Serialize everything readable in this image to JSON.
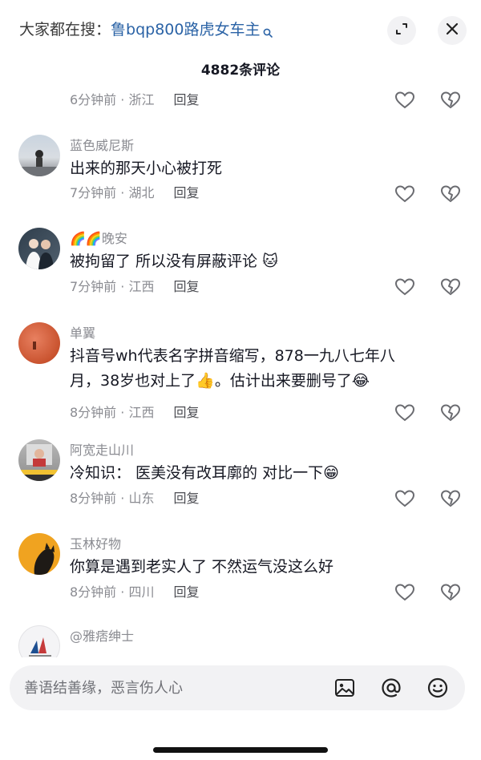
{
  "header": {
    "search_prefix": "大家都在搜：",
    "search_keyword": "鲁bqp800路虎女车主",
    "comment_count": "4882条评论"
  },
  "comments": [
    {
      "username": "",
      "text": "",
      "time": "6分钟前",
      "location": "浙江",
      "reply": "回复"
    },
    {
      "username": "蓝色威尼斯",
      "text": "出来的那天小心被打死",
      "time": "7分钟前",
      "location": "湖北",
      "reply": "回复"
    },
    {
      "username": "🌈🌈晚安",
      "text": "被拘留了 所以没有屏蔽评论",
      "emoji": "🐱",
      "time": "7分钟前",
      "location": "江西",
      "reply": "回复"
    },
    {
      "username": "单翼",
      "text_line1": "抖音号wh代表名字拼音缩写，878一九八七年八",
      "text_line2": "月，38岁也对上了",
      "emoji1": "👍",
      "text_line2b": "。估计出来要删号了",
      "emoji2": "😂",
      "time": "8分钟前",
      "location": "江西",
      "reply": "回复"
    },
    {
      "username": "阿宽走山川",
      "text": "冷知识：  医美没有改耳廓的  对比一下",
      "emoji": "😁",
      "time": "8分钟前",
      "location": "山东",
      "reply": "回复"
    },
    {
      "username": "玉林好物",
      "text": "你算是遇到老实人了 不然运气没这么好",
      "time": "8分钟前",
      "location": "四川",
      "reply": "回复"
    },
    {
      "username": "@雅痞绅士",
      "text": "",
      "time": "",
      "location": "",
      "reply": ""
    }
  ],
  "composer": {
    "placeholder": "善语结善缘，恶言伤人心",
    "icons": [
      "image-icon",
      "at-icon",
      "emoji-icon"
    ]
  },
  "colors": {
    "keyword": "#2b63a6",
    "meta": "#8a8b91",
    "text": "#161823"
  }
}
